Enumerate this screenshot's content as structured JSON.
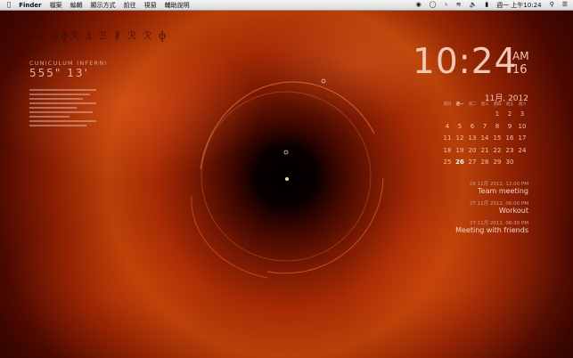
{
  "menubar": {
    "apple_icon": "apple-logo-icon",
    "app_name": "Finder",
    "menus": [
      "檔案",
      "編輯",
      "顯示方式",
      "前往",
      "視窗",
      "輔助說明"
    ],
    "clock_text": "週一 上午10:24",
    "status_icons": [
      "record-icon",
      "chat-bubble-icon",
      "bluetooth-icon",
      "wifi-icon",
      "volume-icon",
      "battery-icon"
    ]
  },
  "widget": {
    "glyphs": "ǝ≡ ɸɸℛ ʎ ℬ ∦ ℛ ℛ ɸ",
    "subtitle": "CUNICULUM INFERNI",
    "coords": "555\" 13'"
  },
  "clock": {
    "time": "10:24",
    "ampm": "AM",
    "seconds": "16"
  },
  "calendar": {
    "month_label": "11月, 2012",
    "weekdays": [
      "週日",
      "週一",
      "週二",
      "週三",
      "週四",
      "週五",
      "週六"
    ],
    "today_weekday": "週一",
    "today": "26",
    "weeks": [
      [
        "",
        "",
        "",
        "",
        "1",
        "2",
        "3"
      ],
      [
        "4",
        "5",
        "6",
        "7",
        "8",
        "9",
        "10"
      ],
      [
        "11",
        "12",
        "13",
        "14",
        "15",
        "16",
        "17"
      ],
      [
        "18",
        "19",
        "20",
        "21",
        "22",
        "23",
        "24"
      ],
      [
        "25",
        "26",
        "27",
        "28",
        "29",
        "30",
        ""
      ]
    ]
  },
  "events": [
    {
      "date": "26 11月 2012, 12:00 PM",
      "title": "Team meeting"
    },
    {
      "date": "27 11月 2012, 06:00 PM",
      "title": "Workout"
    },
    {
      "date": "27 11月 2012, 08:30 PM",
      "title": "Meeting with friends"
    }
  ]
}
